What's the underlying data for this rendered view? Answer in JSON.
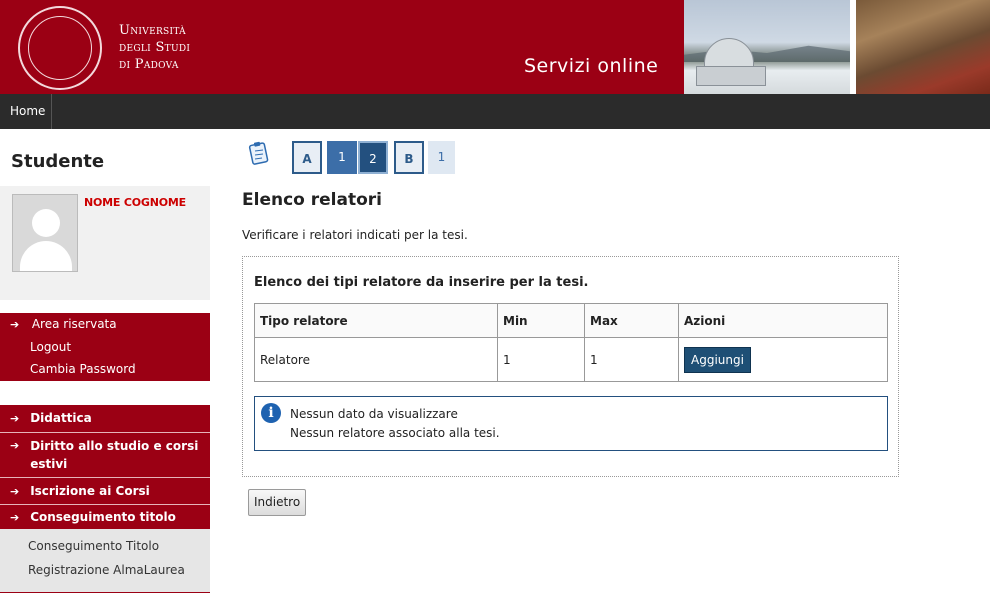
{
  "header": {
    "university_line1": "Università",
    "university_line2": "degli Studi",
    "university_line3": "di Padova",
    "servizi_label": "Servizi online"
  },
  "nav": {
    "home_label": "Home"
  },
  "sidebar": {
    "section_title": "Studente",
    "user_name": "NOME COGNOME",
    "account_items": [
      {
        "label": "Area riservata"
      },
      {
        "label": "Logout"
      },
      {
        "label": "Cambia Password"
      }
    ],
    "menu_items": [
      {
        "label": "Didattica"
      },
      {
        "label": "Diritto allo studio e corsi estivi"
      },
      {
        "label": "Iscrizione ai Corsi"
      },
      {
        "label": "Conseguimento titolo"
      }
    ],
    "sub_items": [
      {
        "label": "Conseguimento Titolo"
      },
      {
        "label": "Registrazione AlmaLaurea"
      }
    ]
  },
  "wizard": {
    "steps": [
      {
        "label": "A"
      },
      {
        "label": "1"
      },
      {
        "label": "2"
      },
      {
        "label": "B"
      },
      {
        "label": "1"
      }
    ]
  },
  "main": {
    "title": "Elenco relatori",
    "description": "Verificare i relatori indicati per la tesi.",
    "panel_title": "Elenco dei tipi relatore da inserire per la tesi.",
    "table": {
      "headers": [
        "Tipo relatore",
        "Min",
        "Max",
        "Azioni"
      ],
      "rows": [
        {
          "tipo": "Relatore",
          "min": "1",
          "max": "1",
          "action_label": "Aggiungi"
        }
      ]
    },
    "info": {
      "line1": "Nessun dato da visualizzare",
      "line2": "Nessun relatore associato alla tesi."
    },
    "back_label": "Indietro"
  },
  "colors": {
    "brand_red": "#9b0014",
    "navbar": "#2b2b2b",
    "step_blue": "#3c6ea8",
    "button_dark_blue": "#1e4f75"
  }
}
